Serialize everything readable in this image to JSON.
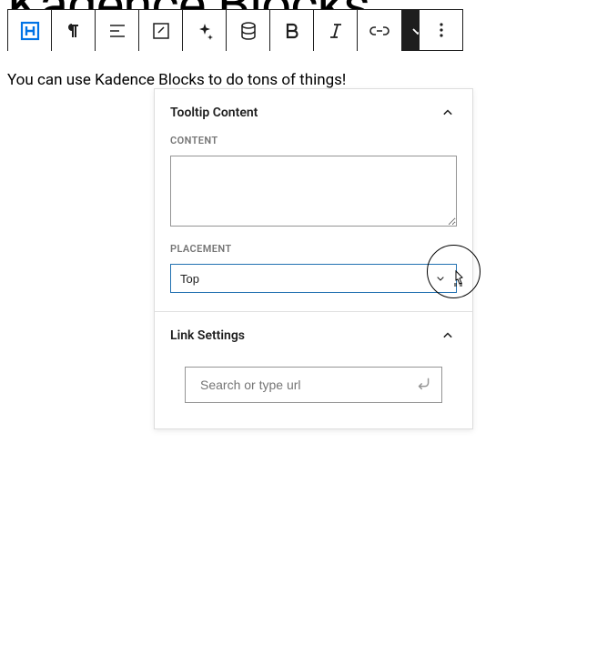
{
  "background_title": "Kadence Blocks",
  "paragraph": "You can use Kadence Blocks to do tons of things!",
  "panel": {
    "tooltip": {
      "header": "Tooltip Content",
      "content_label": "CONTENT",
      "content_value": "",
      "placement_label": "PLACEMENT",
      "placement_value": "Top"
    },
    "link": {
      "header": "Link Settings",
      "url_placeholder": "Search or type url",
      "url_value": ""
    }
  }
}
